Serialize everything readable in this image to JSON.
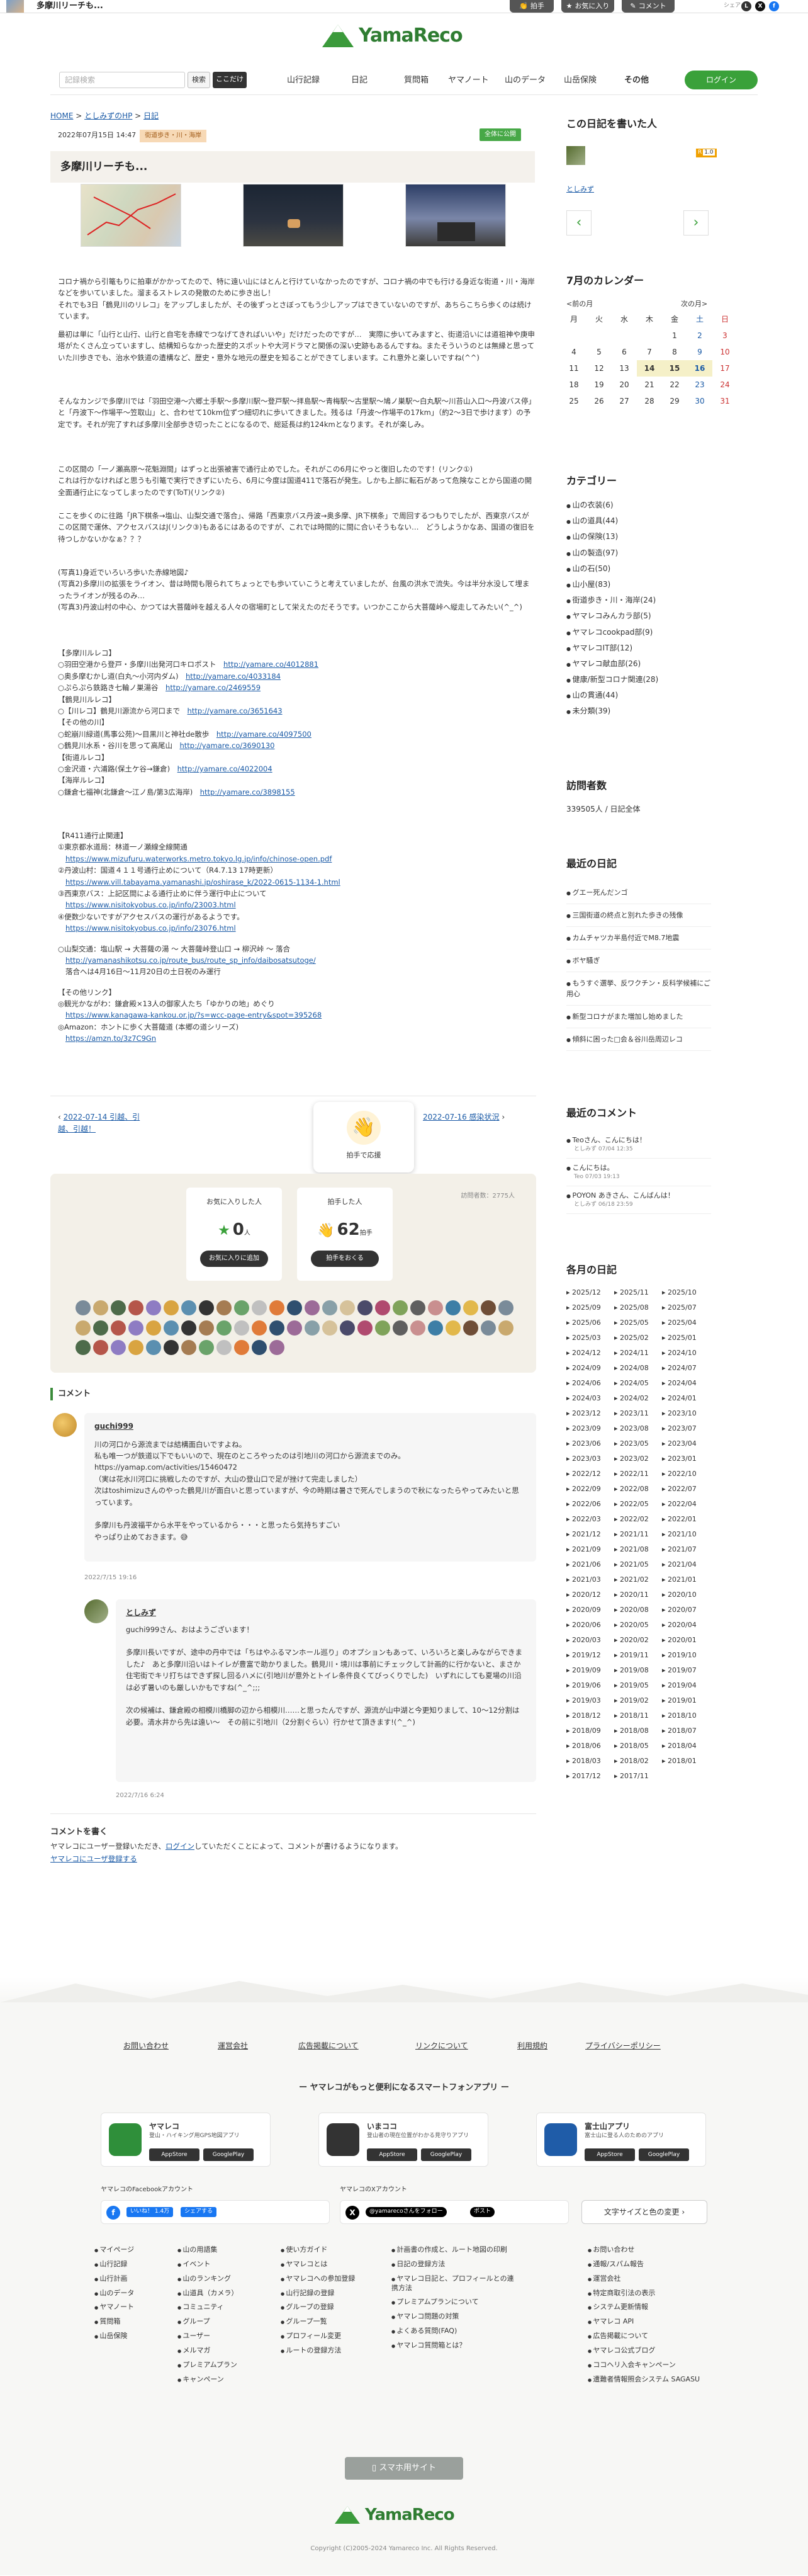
{
  "topbar": {
    "title": "多摩川リーチも...",
    "clap_btn": "拍手",
    "fav_btn": "お気に入り",
    "comment_btn": "コメント",
    "share_label": "シェア"
  },
  "header": {
    "logo": "YamaReco",
    "search_placeholder": "記録検索",
    "search_btn": "検索",
    "kokodake_btn": "ここだけ",
    "nav": [
      "山行記録",
      "日記",
      "質問箱",
      "ヤマノート",
      "山のデータ",
      "山岳保険",
      "その他"
    ],
    "login": "ログイン"
  },
  "breadcrumb": {
    "home": "HOME",
    "user": "としみずのHP",
    "sep": " > ",
    "diary": "日記"
  },
  "entry": {
    "date": "2022年07月15日 14:47",
    "tag": "街道歩き・川・海岸",
    "public": "全体に公開",
    "title": "多摩川リーチも..."
  },
  "body": {
    "p1": "コロナ禍から引篭もりに拍車がかかってたので、特に遠い山にはとんと行けていなかったのですが、コロナ禍の中でも行ける身近な街道・川・海岸などを歩いていました。溜まるストレスの発散のために歩き出し！\nそれでも3日「鶴見川のリレコ」をアップしましたが、その後ずっとさぼってもう少しアップはできていないのですが、あちらこちら歩くのは続けています。",
    "p2": "最初は単に「山行と山行、山行と自宅を赤線でつなげてきればいいや」だけだったのですが…　実際に歩いてみますと、街道沿いには道祖神や庚申塔がたくさん立っていますし、結構知らなかった歴史的スポットや大河ドラマと関係の深い史跡もあるんですね。またそういうのとは無縁と思っていた川歩きでも、治水や鉄道の遺構など、歴史・意外な地元の歴史を知ることができてしまいます。これ意外と楽しいですね(^^)",
    "p3": "そんなカンジで多摩川では「羽田空港〜六郷土手駅〜多摩川駅〜登戸駅〜拝島駅〜青梅駅〜古里駅〜鳩ノ巣駅〜白丸駅〜川苔山入口〜丹波バス停」と「丹波下〜作場平〜笠取山」と、合わせて10km位ずつ細切れに歩いてきました。残るは「丹波〜作場平の17km」（約2〜3日で歩けます）の予定です。それが完了すれば多摩川全部歩き切ったことになるので、総延長は約124kmとなります。それが楽しみ。",
    "p4": "この区間の「一ノ瀬高原〜花魁淵間」はずっと出張被害で通行止めでした。それがこの6月にやっと復旧したのです！(リンク①)\nこれは行かなければと思うも引篭で実行できずにいたら、6月に今度は国道411で落石が発生。しかも上部に転石があって危険なことから国道の開全面通行止になってしまったのです(ToT)(リンク②)",
    "p5": "ここを歩くのに往路「JR下棋条→塩山、山梨交通で落合」、帰路「西東京バス丹波→奥多摩、JR下棋条」で周回するつもりでしたが、西東京バスがこの区間で運休、アクセスバスはJ(リンク③)もあるにはあるのですが、これでは時間的に間に合いそうもない…　どうしようかなあ、国道の復旧を待つしかないかなぁ？？？",
    "p6": "(写真1)身近でいろいろ歩いた赤線地図♪\n(写真2)多摩川の拡張をライオン、昔は時間も限られてちょっとでも歩いていこうと考えていましたが、台風の洪水で流失。今は半分水没して埋まったライオンが残るのみ…\n(写真3)丹波山村の中心、かつては大菩薩峠を越える人々の宿場町として栄えたのだそうです。いつかここから大菩薩峠へ縦走してみたい(^_^)",
    "links": [
      {
        "t": "【多摩川ルレコ】",
        "u": ""
      },
      {
        "t": "○羽田空港から登戸・多摩川出発河口キロポスト",
        "u": "http://yamare.co/4012881"
      },
      {
        "t": "○奥多摩むかし道(白丸〜小河内ダム)",
        "u": "http://yamare.co/4033184"
      },
      {
        "t": "○ぷらぷら鉄路き七輪ノ巣湯谷",
        "u": "http://yamare.co/2469559"
      },
      {
        "t": "【鶴見川ルレコ】",
        "u": ""
      },
      {
        "t": "○【川レコ】鶴見川源流から河口まで",
        "u": "http://yamare.co/3651643"
      },
      {
        "t": "【その他の川】",
        "u": ""
      },
      {
        "t": "○蛇崩川緑道(馬事公苑)〜目黒川と神社de散歩",
        "u": "http://yamare.co/4097500"
      },
      {
        "t": "○鶴見川水系・谷川を思って高尾山",
        "u": "http://yamare.co/3690130"
      },
      {
        "t": "【街道ルレコ】",
        "u": ""
      },
      {
        "t": "○金沢道・六浦路(保土ケ谷→鎌倉)",
        "u": "http://yamare.co/4022004"
      },
      {
        "t": "【海岸ルレコ】",
        "u": ""
      },
      {
        "t": "○鎌倉七福神(北鎌倉〜江ノ島/第3広海岸)",
        "u": "http://yamare.co/3898155"
      }
    ],
    "r411_head": "【R411通行止関連】",
    "r411": [
      {
        "t": "①東京都水道局：林道一ノ瀬線全線開通",
        "u": "https://www.mizufuru.waterworks.metro.tokyo.lg.jp/info/chinose-open.pdf"
      },
      {
        "t": "②丹波山村：国道４１１号通行止めについて（R4.7.13 17時更新）",
        "u": "https://www.vill.tabayama.yamanashi.jp/oshirase_k/2022-0615-1134-1.html"
      },
      {
        "t": "③西東京バス：上記区間による通行止めに伴う運行中止について",
        "u": "https://www.nisitokyobus.co.jp/info/23003.html"
      },
      {
        "t": "④便数少ないですがアクセスバスの運行があるようです。",
        "u": "https://www.nisitokyobus.co.jp/info/23076.html"
      }
    ],
    "bus": "○山梨交通：塩山駅 → 大菩薩の湯 〜 大菩薩峠登山口 → 柳沢峠 〜 落合",
    "bus_u": "http://yamanashikotsu.co.jp/route_bus/route_sp_info/daibosatsutoge/",
    "bus_note": "落合へは4月16日〜11月20日の土日祝のみ運行",
    "other_head": "【その他リンク】",
    "other1": "◎観光かながわ：鎌倉殿×13人の御家人たち「ゆかりの地」めぐり",
    "other1_u": "https://www.kanagawa-kankou.or.jp/?s=wcc-page-entry&spot=395268",
    "other2": "◎Amazon：ホントに歩く大菩薩道 (本郷の道シリーズ)",
    "other2_u": "https://amzn.to/3z7C9Gn"
  },
  "pager": {
    "prev": "2022-07-14 引越、引越、引越！",
    "next": "2022-07-16 感染状況",
    "clap_float": "拍手で応援"
  },
  "stats": {
    "views": "訪問者数：2775人",
    "fav_title": "お気に入りした人",
    "fav_count": "0",
    "fav_unit": "人",
    "fav_btn": "お気に入りに追加",
    "clap_title": "拍手した人",
    "clap_count": "62",
    "clap_unit": "拍手",
    "clap_btn": "拍手をおくる"
  },
  "comments": {
    "head": "コメント",
    "c1": {
      "user": "guchi999",
      "text": "川の河口から源流までは結構面白いですよね。\n私も唯一つが鉄道以下でもいいので、現在のところやったのは引地川の河口から源流までのみ。https://yamap.com/activities/15460472\n（実は花水川河口に挑戦したのですが、大山の登山口で足が挫けて完走しました）\n次はtoshimizuさんのやった鶴見川が面白いと思っていますが、今の時期は暑さで死んでしまうので秋になったらやってみたいと思っています。\n\n多摩川も丹波福平から水平をやっているから・・・と思ったら気持ちすごい\nやっぱり止めておきます。😅",
      "date": "2022/7/15 19:16"
    },
    "c2": {
      "user": "としみず",
      "text": "guchi999さん、おはようございます！\n\n多摩川長いですが、途中の丹中では「ちはやふるマンホール巡り」のオプションもあって、いろいろと楽しみながらできました♪　あと多摩川沿いはトイレが豊富で助かりました。鶴見川・境川は事前にチェックして計画的に行かないと、まさか住宅街でキリ打ちはできず探し回るハメに(引地川が意外とトイレ条件良くてびっくりでした)　いずれにしても夏場の川沿は必ず暑いのも厳しいかもですね(^_^;;;\n\n次の候補は、鎌倉殿の相模川橋脚の辺から相模川……と思ったんですが、源流が山中湖と今更知りまして、10〜12分割は必要。清水井から先は遠い〜　その前に引地川（2分割ぐらい）行かせて頂きます!(^_^)",
      "date": "2022/7/16 6:24"
    }
  },
  "comment_write": {
    "head": "コメントを書く",
    "text1": "ヤマレコにユーザー登録いただき、",
    "login": "ログイン",
    "text2": "していただくことによって、コメントが書けるようになります。",
    "register": "ヤマレコにユーザ登録する"
  },
  "sidebar": {
    "author_head": "この日記を書いた人",
    "author": "としみず",
    "rank": "1.0",
    "cal_head": "7月のカレンダー",
    "cal_prev": "<前の月",
    "cal_next": "次の月>",
    "weekdays": [
      "月",
      "火",
      "水",
      "木",
      "金",
      "土",
      "日"
    ],
    "weeks": [
      [
        "",
        "",
        "",
        "",
        "1",
        "2",
        "3"
      ],
      [
        "4",
        "5",
        "6",
        "7",
        "8",
        "9",
        "10"
      ],
      [
        "11",
        "12",
        "13",
        "14",
        "15",
        "16",
        "17"
      ],
      [
        "18",
        "19",
        "20",
        "21",
        "22",
        "23",
        "24"
      ],
      [
        "25",
        "26",
        "27",
        "28",
        "29",
        "30",
        "31"
      ]
    ],
    "cat_head": "カテゴリー",
    "cats": [
      "山の衣装(6)",
      "山の道具(44)",
      "山の保険(13)",
      "山の製造(97)",
      "山の石(50)",
      "山小屋(83)",
      "街道歩き・川・海岸(24)",
      "ヤマレコみんカラ部(5)",
      "ヤマレコcookpad部(9)",
      "ヤマレコIT部(12)",
      "ヤマレコ献血部(26)",
      "健康/新型コロナ関連(28)",
      "山の貫通(44)",
      "未分類(39)"
    ],
    "visits_head": "訪問者数",
    "visits": "339505人 / 日記全体",
    "recent_head": "最近の日記",
    "recent": [
      "グエー死んだンゴ",
      "三国街道の終点と別れた歩きの残像",
      "カムチャツカ半島付近でM8.7地震",
      "ボヤ騒ぎ",
      "もうすぐ選挙、反ワクチン・反科学候補にご用心",
      "新型コロナがまた増加し始めました",
      "傾斜に困った□会＆谷川岳周辺レコ"
    ],
    "rc_head": "最近のコメント",
    "rc": [
      {
        "t": "Teoさん、こんにちは！",
        "s": "としみず 07/04 12:35"
      },
      {
        "t": "こんにちは。",
        "s": "Teo 07/03 19:13"
      },
      {
        "t": "POYON あきさん、こんばんは！",
        "s": "としみず 06/18 23:59"
      }
    ],
    "arch_head": "各月の日記",
    "arch": [
      "2025/12",
      "2025/11",
      "2025/10",
      "2025/09",
      "2025/08",
      "2025/07",
      "2025/06",
      "2025/05",
      "2025/04",
      "2025/03",
      "2025/02",
      "2025/01",
      "2024/12",
      "2024/11",
      "2024/10",
      "2024/09",
      "2024/08",
      "2024/07",
      "2024/06",
      "2024/05",
      "2024/04",
      "2024/03",
      "2024/02",
      "2024/01",
      "2023/12",
      "2023/11",
      "2023/10",
      "2023/09",
      "2023/08",
      "2023/07",
      "2023/06",
      "2023/05",
      "2023/04",
      "2023/03",
      "2023/02",
      "2023/01",
      "2022/12",
      "2022/11",
      "2022/10",
      "2022/09",
      "2022/08",
      "2022/07",
      "2022/06",
      "2022/05",
      "2022/04",
      "2022/03",
      "2022/02",
      "2022/01",
      "2021/12",
      "2021/11",
      "2021/10",
      "2021/09",
      "2021/08",
      "2021/07",
      "2021/06",
      "2021/05",
      "2021/04",
      "2021/03",
      "2021/02",
      "2021/01",
      "2020/12",
      "2020/11",
      "2020/10",
      "2020/09",
      "2020/08",
      "2020/07",
      "2020/06",
      "2020/05",
      "2020/04",
      "2020/03",
      "2020/02",
      "2020/01",
      "2019/12",
      "2019/11",
      "2019/10",
      "2019/09",
      "2019/08",
      "2019/07",
      "2019/06",
      "2019/05",
      "2019/04",
      "2019/03",
      "2019/02",
      "2019/01",
      "2018/12",
      "2018/11",
      "2018/10",
      "2018/09",
      "2018/08",
      "2018/07",
      "2018/06",
      "2018/05",
      "2018/04",
      "2018/03",
      "2018/02",
      "2018/01",
      "2017/12",
      "2017/11"
    ]
  },
  "footer": {
    "links": [
      "お問い合わせ",
      "運営会社",
      "広告掲載について",
      "リンクについて",
      "利用規約",
      "プライバシーポリシー"
    ],
    "apps_head": "ー ヤマレコがもっと便利になるスマートフォンアプリ ー",
    "apps": [
      {
        "name": "ヤマレコ",
        "desc": "登山・ハイキング用GPS地図アプリ"
      },
      {
        "name": "いまココ",
        "desc": "登山者の現在位置がわかる見守りアプリ"
      },
      {
        "name": "富士山アプリ",
        "desc": "富士山に登る人のためのアプリ"
      }
    ],
    "appstore": "AppStore",
    "googleplay": "GooglePlay",
    "fb_head": "ヤマレコのFacebookアカウント",
    "fb_like": "いいね！ 1.4万",
    "fb_share": "シェアする",
    "x_head": "ヤマレコのXアカウント",
    "x_follow": "@yamarecoさんをフォロー",
    "x_post": "ポスト",
    "fontbtn": "文字サイズと色の変更",
    "col1": [
      "マイページ",
      "山行記録",
      "山行計画",
      "山のデータ",
      "ヤマノート",
      "質問箱",
      "山岳保険"
    ],
    "col2": [
      "山の用語集",
      "イベント",
      "山のランキング",
      "山道具（カメラ）",
      "コミュニティ",
      "グループ",
      "ユーザー",
      "メルマガ",
      "プレミアムプラン",
      "キャンペーン"
    ],
    "col3": [
      "使い方ガイド",
      "ヤマレコとは",
      "ヤマレコへの参加登録",
      "山行記録の登録",
      "グループの登録",
      "グループ一覧",
      "プロフィール変更",
      "ルートの登録方法"
    ],
    "col4": [
      "計画書の作成と、ルート地図の印刷",
      "日記の登録方法",
      "ヤマレコ日記と、プロフィールとの連携方法",
      "プレミアムプランについて",
      "ヤマレコ問題の対策",
      "よくある質問(FAQ)",
      "ヤマレコ質問箱とは？"
    ],
    "col5": [
      "お問い合わせ",
      "通報/スパム報告",
      "運営会社",
      "特定商取引法の表示",
      "システム更新情報",
      "ヤマレコ API",
      "広告掲載について",
      "ヤマレコ公式ブログ",
      "ココヘリ入会キャンペーン",
      "遭難者情報照会システム SAGASU"
    ],
    "sp": "スマホ用サイト",
    "logo": "YamaReco",
    "copy": "Copyright (C)2005-2024 Yamareco Inc. All Rights Reserved."
  }
}
